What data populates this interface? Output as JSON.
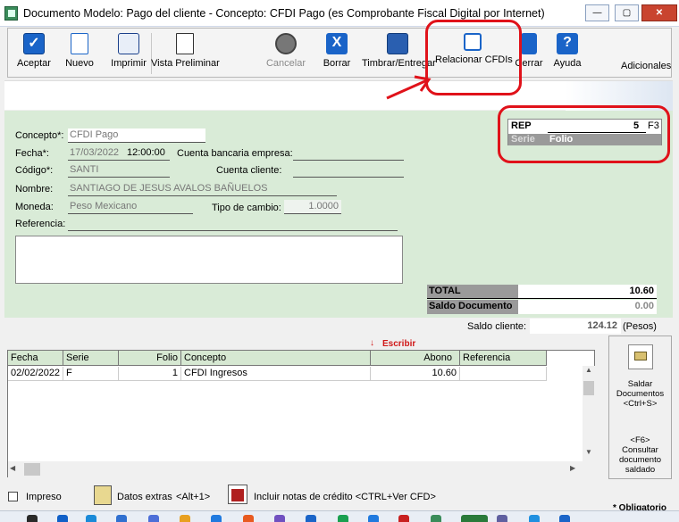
{
  "window": {
    "title": "Documento Modelo: Pago del cliente - Concepto: CFDI Pago (es Comprobante Fiscal Digital por Internet)",
    "minimize": "—",
    "maximize": "▢",
    "close": "✕"
  },
  "toolbar": {
    "aceptar": "Aceptar",
    "nuevo": "Nuevo",
    "imprimir": "Imprimir",
    "vista_preliminar": "Vista Preliminar",
    "cancelar": "Cancelar",
    "borrar": "Borrar",
    "timbrar": "Timbrar/Entregar",
    "relacionar": "Relacionar CFDIs",
    "cerrar": "Cerrar",
    "ayuda": "Ayuda",
    "adicionales": "Adicionales"
  },
  "form": {
    "concepto_label": "Concepto*:",
    "concepto_value": "CFDI Pago",
    "fecha_label": "Fecha*:",
    "fecha_value": "17/03/2022",
    "hora_value": "12:00:00",
    "cuenta_bancaria_label": "Cuenta bancaria empresa:",
    "cuenta_bancaria_value": "",
    "codigo_label": "Código*:",
    "codigo_value": "SANTI",
    "cuenta_cliente_label": "Cuenta cliente:",
    "cuenta_cliente_value": "",
    "nombre_label": "Nombre:",
    "nombre_value": "SANTIAGO DE JESUS AVALOS BAÑUELOS",
    "moneda_label": "Moneda:",
    "moneda_value": "Peso Mexicano",
    "tipo_cambio_label": "Tipo de cambio:",
    "tipo_cambio_value": "1.0000",
    "referencia_label": "Referencia:",
    "referencia_value": ""
  },
  "rep": {
    "serie_value": "REP",
    "folio_value": "5",
    "f3": "F3",
    "serie_label": "Serie",
    "folio_label": "Folio"
  },
  "totals": {
    "total_label": "TOTAL",
    "total_value": "10.60",
    "saldo_doc_label": "Saldo Documento",
    "saldo_doc_value": "0.00",
    "saldo_cliente_label": "Saldo cliente:",
    "saldo_cliente_value": "124.12",
    "saldo_cliente_currency": "(Pesos)"
  },
  "grid": {
    "escribir": "Escribir",
    "columns": [
      "Fecha",
      "Serie",
      "Folio",
      "Concepto",
      "Abono",
      "Referencia"
    ],
    "rows": [
      {
        "fecha": "02/02/2022",
        "serie": "F",
        "folio": "1",
        "concepto": "CFDI Ingresos",
        "abono": "10.60",
        "referencia": ""
      }
    ]
  },
  "side": {
    "saldar_line1": "Saldar",
    "saldar_line2": "Documentos",
    "saldar_line3": "<Ctrl+S>",
    "consultar_line1": "<F6>",
    "consultar_line2": "Consultar",
    "consultar_line3": "documento",
    "consultar_line4": "saldado"
  },
  "bottom": {
    "impreso": "Impreso",
    "datos_extras": "Datos extras",
    "datos_extras_key": "<Alt+1>",
    "incluir_notas": "Incluir notas de crédito <CTRL+Ver CFD>",
    "obligatorio": "* Obligatorio"
  }
}
